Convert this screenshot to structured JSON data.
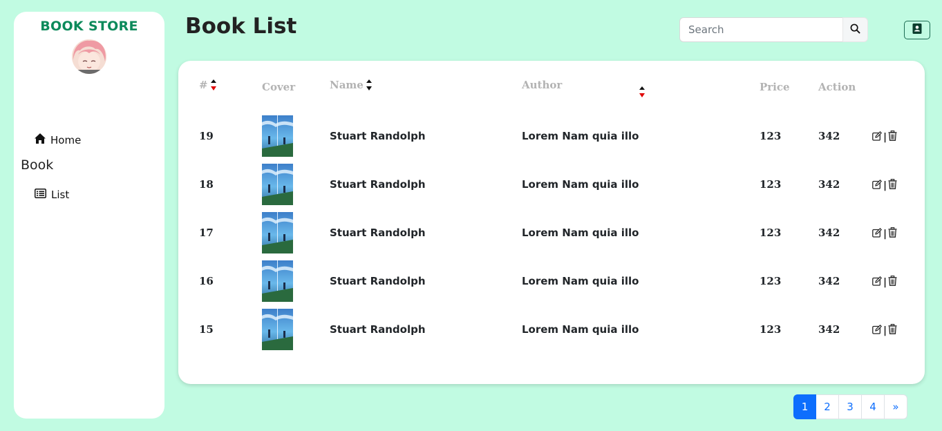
{
  "sidebar": {
    "brand": "BOOK STORE",
    "nav": {
      "home_label": "Home",
      "section_label": "Book",
      "list_label": "List"
    }
  },
  "header": {
    "title": "Book List",
    "search": {
      "placeholder": "Search",
      "value": ""
    }
  },
  "table": {
    "columns": [
      "#",
      "Cover",
      "Name",
      "Author",
      "Price",
      "Action"
    ],
    "rows": [
      {
        "id": "19",
        "name": "Stuart Randolph",
        "author": "Lorem Nam quia illo",
        "price": "123",
        "action": "342"
      },
      {
        "id": "18",
        "name": "Stuart Randolph",
        "author": "Lorem Nam quia illo",
        "price": "123",
        "action": "342"
      },
      {
        "id": "17",
        "name": "Stuart Randolph",
        "author": "Lorem Nam quia illo",
        "price": "123",
        "action": "342"
      },
      {
        "id": "16",
        "name": "Stuart Randolph",
        "author": "Lorem Nam quia illo",
        "price": "123",
        "action": "342"
      },
      {
        "id": "15",
        "name": "Stuart Randolph",
        "author": "Lorem Nam quia illo",
        "price": "123",
        "action": "342"
      }
    ],
    "row_action_separator": "|"
  },
  "pagination": {
    "pages": [
      "1",
      "2",
      "3",
      "4"
    ],
    "current": "1",
    "next": "»"
  },
  "icons": {
    "home": "home-icon",
    "list": "list-icon",
    "search": "search-icon",
    "add_book": "address-book-icon",
    "edit": "edit-icon",
    "delete": "trash-icon",
    "sort": "sort-icon"
  },
  "colors": {
    "background": "#c1fbe2",
    "brand": "#0c8a5b",
    "primary": "#0d6efd",
    "sort_active": "#e00000",
    "header_text": "#b3b3b3"
  }
}
